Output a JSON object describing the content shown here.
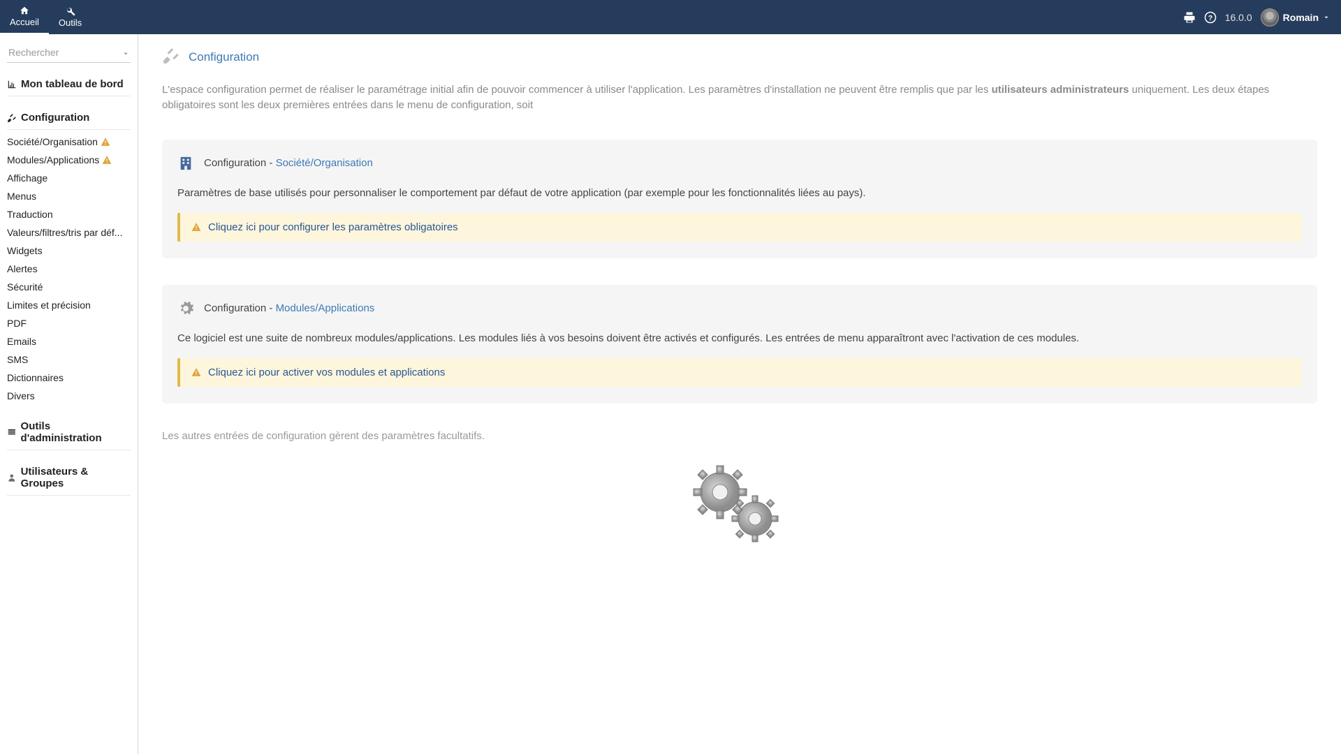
{
  "topbar": {
    "items": [
      {
        "label": "Accueil",
        "name": "nav-home"
      },
      {
        "label": "Outils",
        "name": "nav-tools"
      }
    ],
    "version": "16.0.0",
    "user": "Romain"
  },
  "sidebar": {
    "search_placeholder": "Rechercher",
    "dashboard": "Mon tableau de bord",
    "configuration_heading": "Configuration",
    "config_items": [
      {
        "label": "Société/Organisation",
        "warn": true
      },
      {
        "label": "Modules/Applications",
        "warn": true
      },
      {
        "label": "Affichage",
        "warn": false
      },
      {
        "label": "Menus",
        "warn": false
      },
      {
        "label": "Traduction",
        "warn": false
      },
      {
        "label": "Valeurs/filtres/tris par déf...",
        "warn": false
      },
      {
        "label": "Widgets",
        "warn": false
      },
      {
        "label": "Alertes",
        "warn": false
      },
      {
        "label": "Sécurité",
        "warn": false
      },
      {
        "label": "Limites et précision",
        "warn": false
      },
      {
        "label": "PDF",
        "warn": false
      },
      {
        "label": "Emails",
        "warn": false
      },
      {
        "label": "SMS",
        "warn": false
      },
      {
        "label": "Dictionnaires",
        "warn": false
      },
      {
        "label": "Divers",
        "warn": false
      }
    ],
    "admin_tools": "Outils d'administration",
    "users_groups": "Utilisateurs & Groupes"
  },
  "page": {
    "title": "Configuration",
    "intro_1": "L'espace configuration permet de réaliser le paramétrage initial afin de pouvoir commencer à utiliser l'application. Les paramètres d'installation ne peuvent être remplis que par les ",
    "intro_bold": "utilisateurs administrateurs",
    "intro_2": " uniquement. Les deux étapes obligatoires sont les deux premières entrées dans le menu de configuration, soit",
    "card1": {
      "prefix": "Configuration - ",
      "title": "Société/Organisation",
      "body": "Paramètres de base utilisés pour personnaliser le comportement par défaut de votre application (par exemple pour les fonctionnalités liées au pays).",
      "alert": "Cliquez ici pour configurer les paramètres obligatoires"
    },
    "card2": {
      "prefix": "Configuration - ",
      "title": "Modules/Applications",
      "body": "Ce logiciel est une suite de nombreux modules/applications. Les modules liés à vos besoins doivent être activés et configurés. Les entrées de menu apparaîtront avec l'activation de ces modules.",
      "alert": "Cliquez ici pour activer vos modules et applications"
    },
    "outro": "Les autres entrées de configuration gèrent des paramètres facultatifs."
  }
}
